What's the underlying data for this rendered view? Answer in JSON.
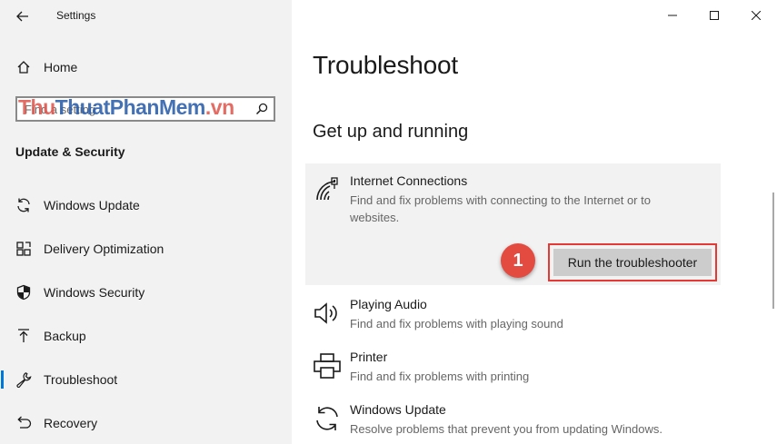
{
  "window": {
    "app_title": "Settings",
    "controls": {
      "minimize": "minimize",
      "maximize": "maximize",
      "close": "close"
    }
  },
  "sidebar": {
    "home_label": "Home",
    "search_placeholder": "Find a setting",
    "watermark": {
      "part1": "Thu",
      "part2": "ThuatPhanMem",
      "part3": ".vn"
    },
    "section_heading": "Update & Security",
    "items": [
      {
        "label": "Windows Update",
        "icon": "sync-icon"
      },
      {
        "label": "Delivery Optimization",
        "icon": "delivery-optimization-icon"
      },
      {
        "label": "Windows Security",
        "icon": "shield-icon"
      },
      {
        "label": "Backup",
        "icon": "backup-arrow-icon"
      },
      {
        "label": "Troubleshoot",
        "icon": "wrench-icon",
        "selected": true
      },
      {
        "label": "Recovery",
        "icon": "recovery-icon"
      }
    ]
  },
  "main": {
    "page_title": "Troubleshoot",
    "section_title": "Get up and running",
    "troubleshooters": [
      {
        "title": "Internet Connections",
        "description": "Find and fix problems with connecting to the Internet or to websites.",
        "icon": "wifi-icon",
        "expanded": true
      },
      {
        "title": "Playing Audio",
        "description": "Find and fix problems with playing sound",
        "icon": "speaker-icon"
      },
      {
        "title": "Printer",
        "description": "Find and fix problems with printing",
        "icon": "printer-icon"
      },
      {
        "title": "Windows Update",
        "description": "Resolve problems that prevent you from updating Windows.",
        "icon": "sync-icon"
      }
    ],
    "run_button_label": "Run the troubleshooter",
    "step_badge": "1",
    "colors": {
      "accent": "#0078d7",
      "highlight_red": "#e53935",
      "badge_red": "#e34b40"
    }
  }
}
